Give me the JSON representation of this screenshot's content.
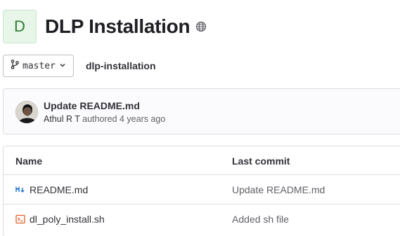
{
  "project": {
    "avatar_letter": "D",
    "title": "DLP Installation",
    "visibility_icon": "globe-icon"
  },
  "branch": {
    "icon": "branch-icon",
    "name": "master",
    "dropdown_icon": "chevron-down-icon",
    "breadcrumb": "dlp-installation"
  },
  "last_commit": {
    "message": "Update README.md",
    "author": "Athul R T",
    "action": "authored",
    "time": "4 years ago"
  },
  "table": {
    "headers": {
      "name": "Name",
      "last_commit": "Last commit"
    },
    "rows": [
      {
        "name": "README.md",
        "icon": "markdown-icon",
        "last_commit": "Update README.md"
      },
      {
        "name": "dl_poly_install.sh",
        "icon": "shell-script-icon",
        "last_commit": "Added sh file"
      }
    ]
  },
  "colors": {
    "avatar_bg": "#e8f5e9",
    "avatar_text": "#2e7d32",
    "markdown_icon": "#1f75cb",
    "shell_icon": "#e2622c"
  }
}
